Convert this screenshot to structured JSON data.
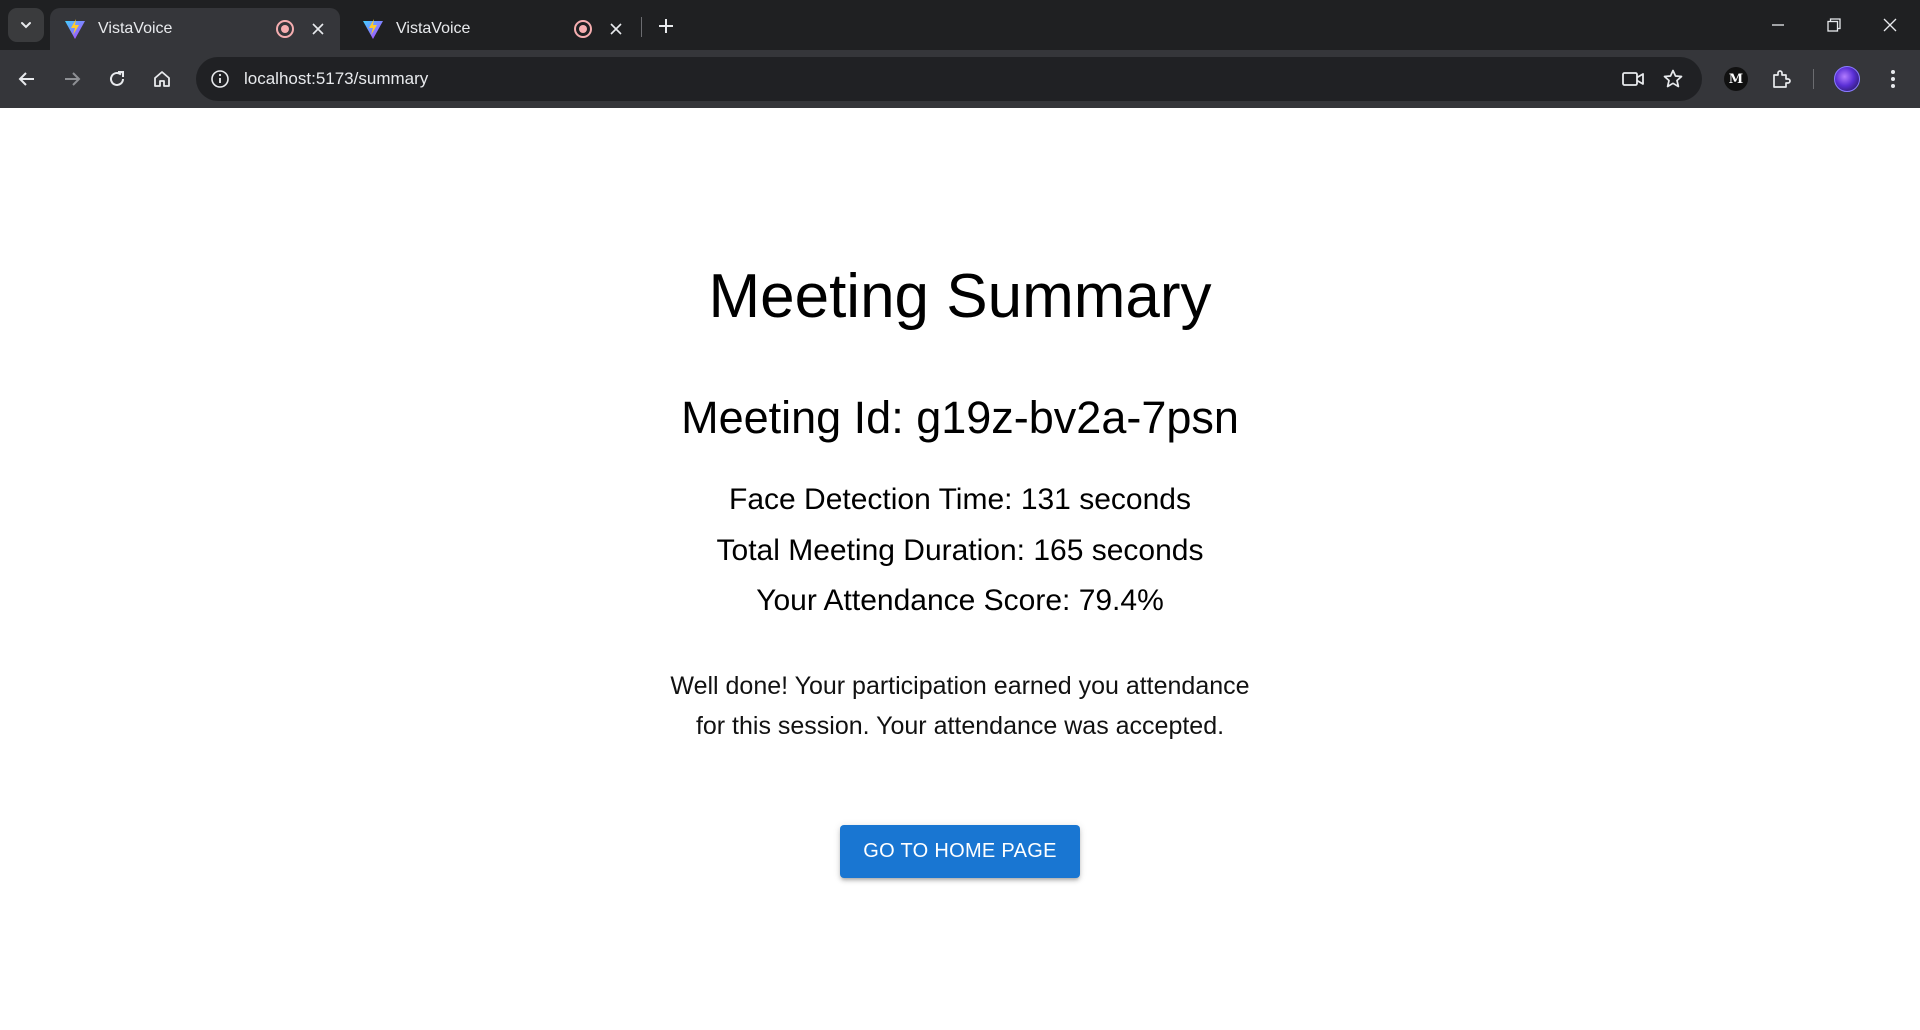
{
  "browser": {
    "tabs": [
      {
        "title": "VistaVoice",
        "active": true,
        "recording": true,
        "favicon": "vite-icon"
      },
      {
        "title": "VistaVoice",
        "active": false,
        "recording": true,
        "favicon": "vite-icon"
      }
    ],
    "url": "localhost:5173/summary"
  },
  "page": {
    "title": "Meeting Summary",
    "meeting_id": "Meeting Id: g19z-bv2a-7psn",
    "stats": {
      "face_detection": "Face Detection Time: 131 seconds",
      "total_duration": "Total Meeting Duration: 165 seconds",
      "attendance_score": "Your Attendance Score: 79.4%"
    },
    "message_line1": "Well done! Your participation earned you attendance",
    "message_line2": "for this session. Your attendance was accepted.",
    "home_button": "GO TO HOME PAGE"
  },
  "colors": {
    "accent": "#1976d2",
    "chrome_dark": "#1f2022",
    "chrome_toolbar": "#35363a",
    "recording": "#f6aeb0"
  }
}
